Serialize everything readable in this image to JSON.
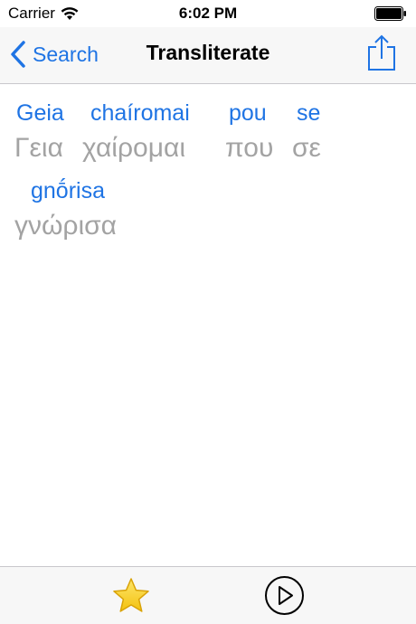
{
  "status_bar": {
    "carrier": "Carrier",
    "time": "6:02 PM"
  },
  "nav": {
    "back_label": "Search",
    "title": "Transliterate"
  },
  "transliteration": {
    "lines": [
      {
        "latin": [
          "Geia",
          "chaíromai",
          "pou",
          "se"
        ],
        "greek": [
          "Γεια",
          "χαίρομαι",
          "που",
          "σε"
        ]
      },
      {
        "latin": [
          "gnṓrisa"
        ],
        "greek": [
          "γνώρισα"
        ]
      }
    ]
  },
  "toolbar": {
    "favorite_icon": "star-icon",
    "play_icon": "play-icon"
  },
  "colors": {
    "accent": "#1f74e4",
    "greek_text": "#a3a3a3",
    "favorite_star": "#f7d31c"
  }
}
